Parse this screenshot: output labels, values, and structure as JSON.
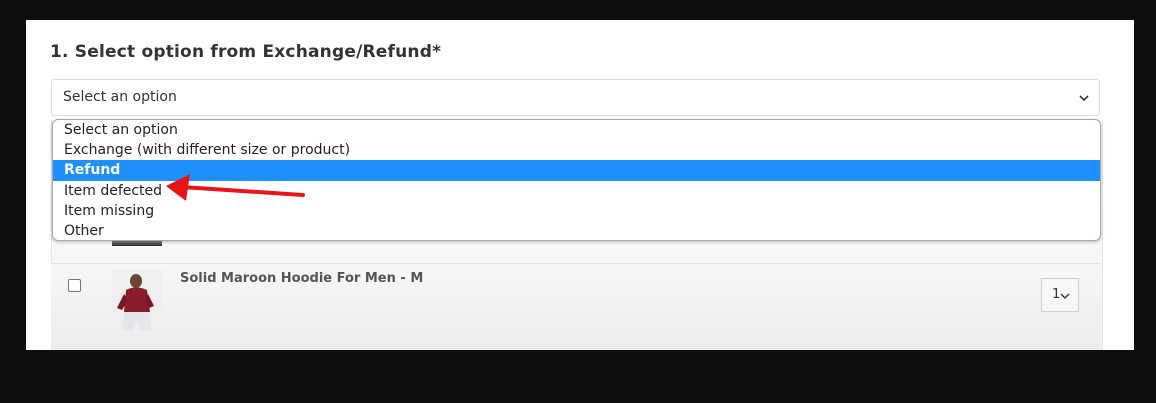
{
  "form": {
    "heading": "1. Select option from Exchange/Refund*",
    "select": {
      "value": "Select an option",
      "options": [
        "Select an option",
        "Exchange (with different size or product)",
        "Refund",
        "Item defected",
        "Item missing",
        "Other"
      ],
      "highlighted": "Refund"
    }
  },
  "products": [
    {
      "title": "Solid Maroon Hoodie For Men - M",
      "quantity": "1",
      "checked": false
    }
  ],
  "annotation": {
    "arrow_color": "#e8141a",
    "points_to": "Item defected"
  },
  "colors": {
    "highlight": "#1e90ff",
    "background": "#0e0e0e"
  }
}
